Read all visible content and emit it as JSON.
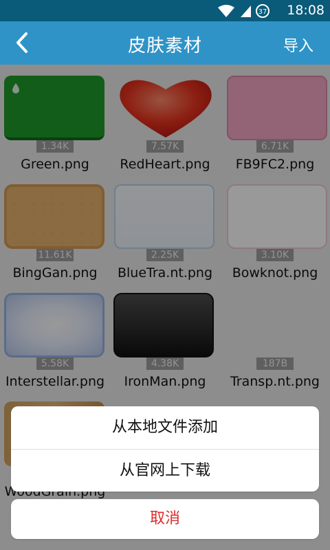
{
  "status_bar": {
    "time": "18:08",
    "battery_level": "37",
    "icons": [
      "wifi-icon",
      "signal-icon",
      "battery-icon"
    ]
  },
  "app_bar": {
    "title": "皮肤素材",
    "back_icon": "chevron-left-icon",
    "import_label": "导入"
  },
  "files": [
    {
      "size": "1.34K",
      "name": "Green.png"
    },
    {
      "size": "7.57K",
      "name": "RedHeart.png"
    },
    {
      "size": "6.71K",
      "name": "FB9FC2.png"
    },
    {
      "size": "11.61K",
      "name": "BingGan.png"
    },
    {
      "size": "2.25K",
      "name": "BlueTra.nt.png"
    },
    {
      "size": "3.10K",
      "name": "Bowknot.png"
    },
    {
      "size": "5.58K",
      "name": "Interstellar.png"
    },
    {
      "size": "4.38K",
      "name": "IronMan.png"
    },
    {
      "size": "187B",
      "name": "Transp.nt.png"
    },
    {
      "size": "",
      "name": "WoodGrain.png"
    }
  ],
  "action_sheet": {
    "option_local": "从本地文件添加",
    "option_web": "从官网上下载",
    "cancel": "取消"
  },
  "colors": {
    "status_bar": "#0a5a79",
    "app_bar": "#2f93c7",
    "cancel_text": "#e02a2a"
  }
}
